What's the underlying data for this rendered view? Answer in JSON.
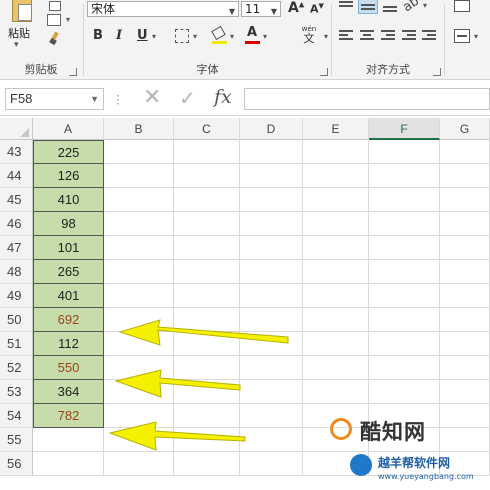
{
  "ribbon": {
    "clipboard": {
      "paste_label": "粘贴",
      "group_label": "剪贴板"
    },
    "font": {
      "font_name": "宋体",
      "font_size": "11",
      "grow_label": "A",
      "shrink_label": "A",
      "bold": "B",
      "italic": "I",
      "underline": "U",
      "wen_label": "wén",
      "wen_char": "文",
      "font_color_letter": "A",
      "group_label": "字体"
    },
    "alignment": {
      "group_label": "对齐方式"
    }
  },
  "formula_bar": {
    "name_box": "F58",
    "fx_label": "fx",
    "formula": ""
  },
  "sheet": {
    "columns": [
      "A",
      "B",
      "C",
      "D",
      "E",
      "F",
      "G"
    ],
    "selected_column": "F",
    "rows": [
      {
        "num": "43",
        "a": "225",
        "highlight": false,
        "filled": true
      },
      {
        "num": "44",
        "a": "126",
        "highlight": false,
        "filled": true
      },
      {
        "num": "45",
        "a": "410",
        "highlight": false,
        "filled": true
      },
      {
        "num": "46",
        "a": "98",
        "highlight": false,
        "filled": true
      },
      {
        "num": "47",
        "a": "101",
        "highlight": false,
        "filled": true
      },
      {
        "num": "48",
        "a": "265",
        "highlight": false,
        "filled": true
      },
      {
        "num": "49",
        "a": "401",
        "highlight": false,
        "filled": true
      },
      {
        "num": "50",
        "a": "692",
        "highlight": true,
        "filled": true
      },
      {
        "num": "51",
        "a": "112",
        "highlight": false,
        "filled": true
      },
      {
        "num": "52",
        "a": "550",
        "highlight": true,
        "filled": true
      },
      {
        "num": "53",
        "a": "364",
        "highlight": false,
        "filled": true
      },
      {
        "num": "54",
        "a": "782",
        "highlight": true,
        "filled": true
      },
      {
        "num": "55",
        "a": "",
        "highlight": false,
        "filled": false
      },
      {
        "num": "56",
        "a": "",
        "highlight": false,
        "filled": false
      }
    ]
  },
  "colors": {
    "cell_fill": "#c6dcab",
    "highlight_text": "#9c4416",
    "arrow": "#f5f000",
    "selected_header": "#217346"
  },
  "watermark": {
    "brand": "酷知网",
    "site_cn": "越羊帮软件网",
    "site_url": "www.yueyangbang.com"
  }
}
